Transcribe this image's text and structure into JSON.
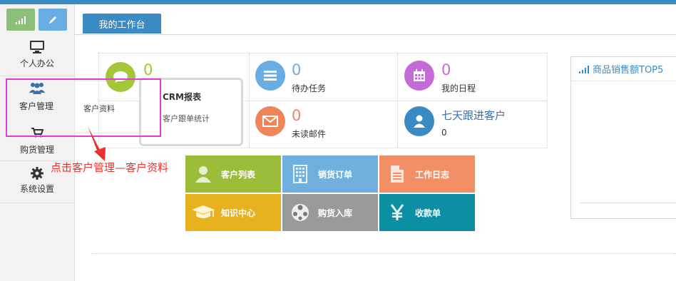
{
  "sidebar": {
    "items": [
      {
        "label": "个人办公",
        "icon": "monitor-icon"
      },
      {
        "label": "客户管理",
        "icon": "users-icon"
      },
      {
        "label": "购货管理",
        "icon": "cart-icon"
      },
      {
        "label": "系统设置",
        "icon": "gear-icon"
      }
    ],
    "submenu_item": "客户资料"
  },
  "tab": {
    "label": "我的工作台"
  },
  "stats": [
    {
      "value": "0",
      "label": "",
      "color": "#a4c639",
      "icon": "chat-icon"
    },
    {
      "value": "0",
      "label": "待办任务",
      "color": "#6aade2",
      "icon": "list-icon"
    },
    {
      "value": "0",
      "label": "我的日程",
      "color": "#c46bd6",
      "icon": "calendar-icon"
    },
    {
      "value": "0",
      "label": "未读邮件",
      "color": "#f0855a",
      "icon": "mail-icon"
    },
    {
      "title": "七天跟进客户",
      "value": "0",
      "color": "#3a8ac4",
      "icon": "person-icon"
    }
  ],
  "popup": {
    "title": "CRM报表",
    "subtitle": "客户跟单统计"
  },
  "tiles": [
    {
      "label": "客户列表",
      "color": "#9cbd3a",
      "icon": "user-icon"
    },
    {
      "label": "销货订单",
      "color": "#6fb0df",
      "icon": "building-icon"
    },
    {
      "label": "工作日志",
      "color": "#f38f66",
      "icon": "document-icon"
    },
    {
      "label": "知识中心",
      "color": "#e7b11f",
      "icon": "graduation-cap-icon"
    },
    {
      "label": "购货入库",
      "color": "#9a9a9a",
      "icon": "ball-icon"
    },
    {
      "label": "收款单",
      "color": "#0d8fa3",
      "icon": "yen-icon"
    }
  ],
  "panel": {
    "title": "商品销售额TOP5"
  },
  "annotation": {
    "text": "点击客户管理—客户资料",
    "color": "#e8332c",
    "highlight_color": "#e23be0"
  }
}
